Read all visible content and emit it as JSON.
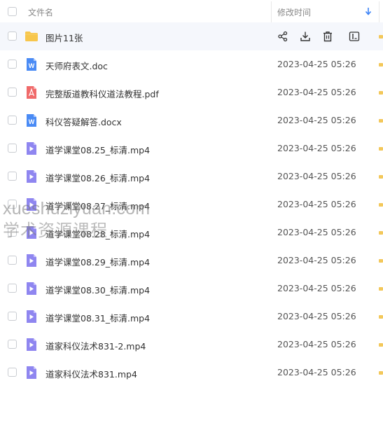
{
  "header": {
    "name_label": "文件名",
    "time_label": "修改时间"
  },
  "files": [
    {
      "name": "图片11张",
      "time": "",
      "icon": "folder-icon"
    },
    {
      "name": "天师府表文.doc",
      "time": "2023-04-25 05:26",
      "icon": "word-doc-icon"
    },
    {
      "name": "完整版道教科仪道法教程.pdf",
      "time": "2023-04-25 05:26",
      "icon": "pdf-icon"
    },
    {
      "name": "科仪答疑解答.docx",
      "time": "2023-04-25 05:26",
      "icon": "word-doc-icon"
    },
    {
      "name": "道学课堂08.25_标清.mp4",
      "time": "2023-04-25 05:26",
      "icon": "video-icon"
    },
    {
      "name": "道学课堂08.26_标清.mp4",
      "time": "2023-04-25 05:26",
      "icon": "video-icon"
    },
    {
      "name": "道学课堂08.27_标清.mp4",
      "time": "2023-04-25 05:26",
      "icon": "video-icon"
    },
    {
      "name": "道学课堂08.28_标清.mp4",
      "time": "2023-04-25 05:26",
      "icon": "video-icon"
    },
    {
      "name": "道学课堂08.29_标清.mp4",
      "time": "2023-04-25 05:26",
      "icon": "video-icon"
    },
    {
      "name": "道学课堂08.30_标清.mp4",
      "time": "2023-04-25 05:26",
      "icon": "video-icon"
    },
    {
      "name": "道学课堂08.31_标清.mp4",
      "time": "2023-04-25 05:26",
      "icon": "video-icon"
    },
    {
      "name": "道家科仪法术831-2.mp4",
      "time": "2023-04-25 05:26",
      "icon": "video-icon"
    },
    {
      "name": "道家科仪法术831.mp4",
      "time": "2023-04-25 05:26",
      "icon": "video-icon"
    }
  ],
  "row_actions": [
    "share-icon",
    "download-icon",
    "delete-icon",
    "rename-icon"
  ],
  "watermark": {
    "line1": "xueshuziyuan.com",
    "line2": "学术资源课程"
  },
  "colors": {
    "folder": "#f7c64c",
    "word": "#4a8bf5",
    "pdf": "#f06a6a",
    "video": "#8f86f0",
    "hover_row": "#f5f7fc",
    "accent": "#3b82f6"
  }
}
